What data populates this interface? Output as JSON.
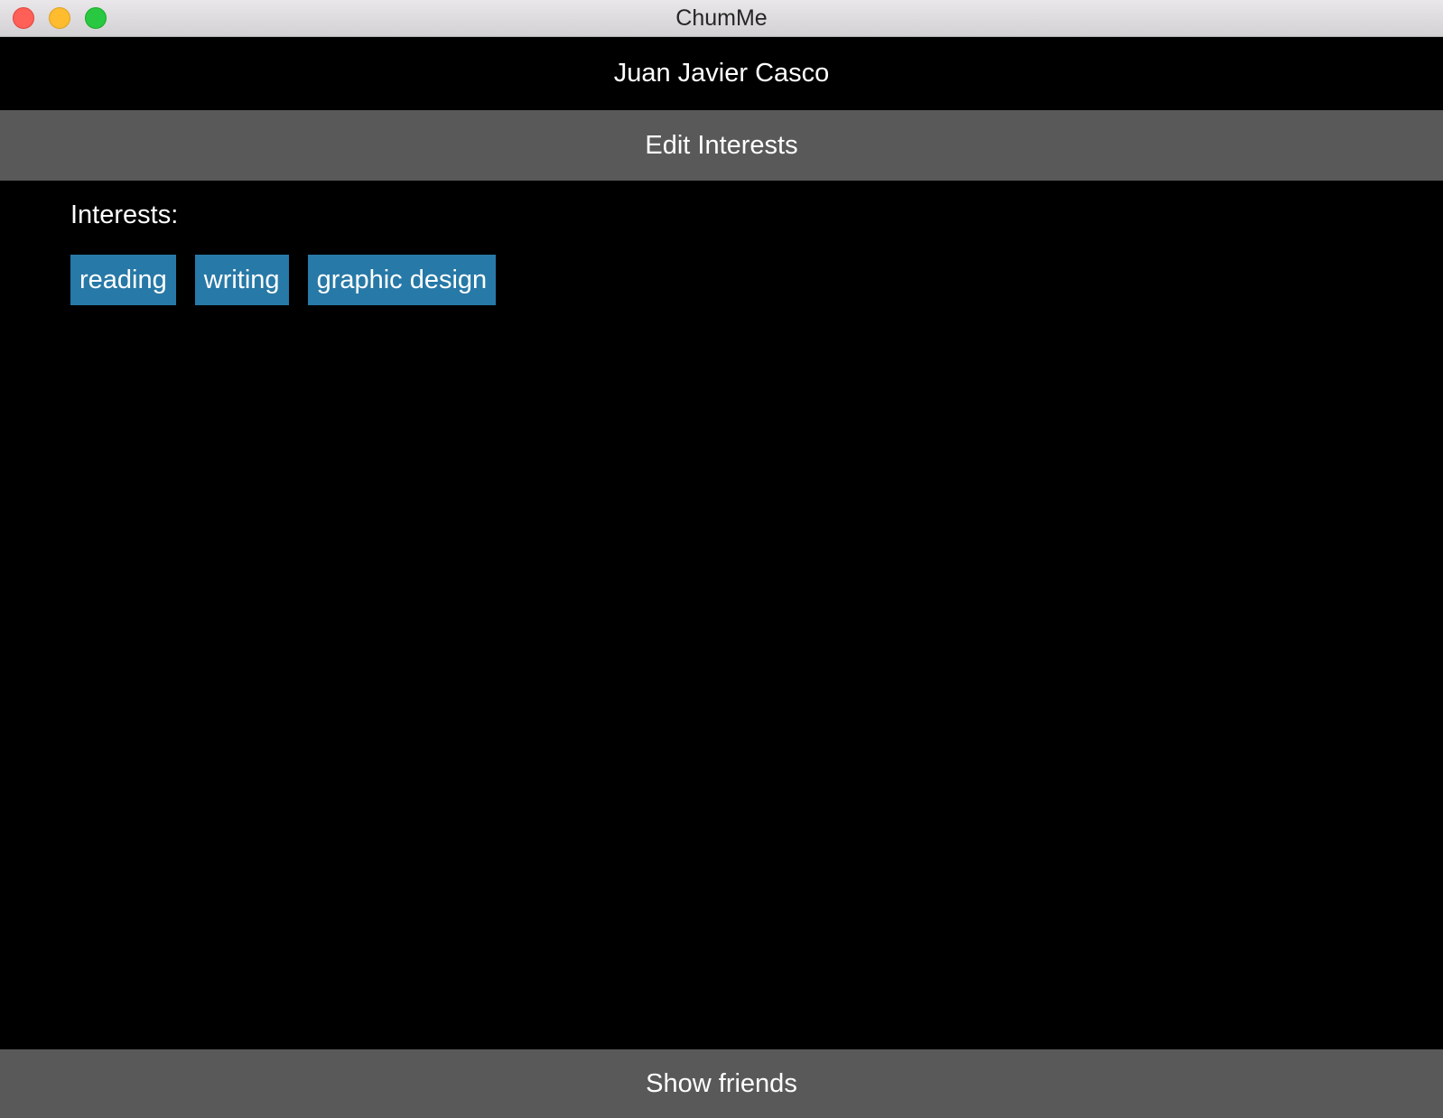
{
  "window": {
    "title": "ChumMe"
  },
  "profile": {
    "name": "Juan Javier Casco"
  },
  "actions": {
    "edit_interests_label": "Edit Interests",
    "show_friends_label": "Show friends"
  },
  "interests": {
    "label": "Interests:",
    "items": [
      "reading",
      "writing",
      "graphic design"
    ]
  },
  "colors": {
    "background": "#000000",
    "button_bar": "#595959",
    "chip": "#2779a7",
    "text": "#ffffff"
  }
}
